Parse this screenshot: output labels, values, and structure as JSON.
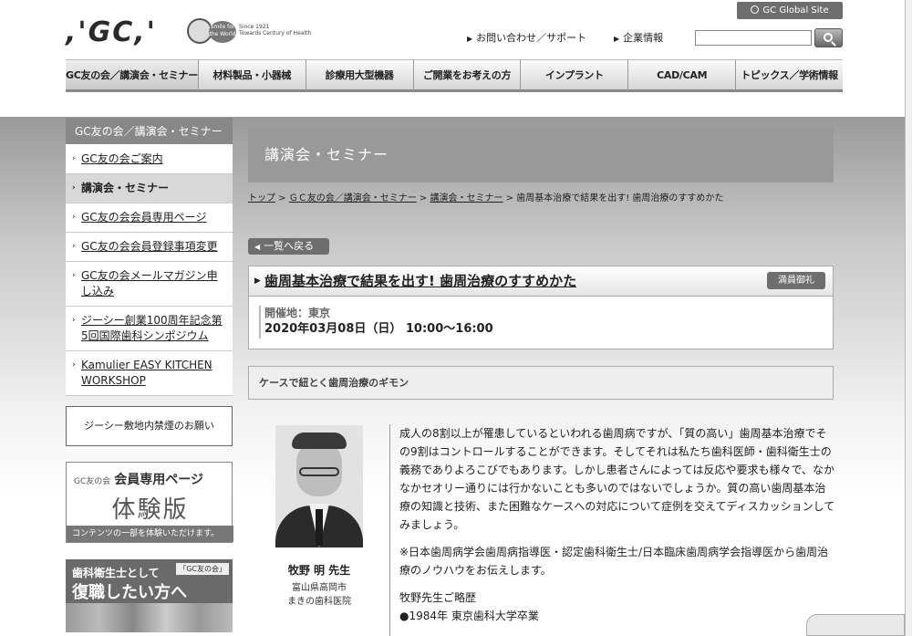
{
  "header": {
    "logo_text": ",'GC,'",
    "badge_text": "Smile for the World",
    "since_text": "Since 1921",
    "since_sub": "Towards Century of Health",
    "global_site": "GC Global Site",
    "utility_links": [
      "お問い合わせ／サポート",
      "企業情報"
    ],
    "search": {
      "value": "",
      "placeholder": ""
    }
  },
  "global_nav": [
    "GC友の会／講演会・セミナー",
    "材料製品・小器械",
    "診療用大型機器",
    "ご開業をお考えの方",
    "インプラント",
    "CAD/CAM",
    "トピックス／学術情報"
  ],
  "sidebar": {
    "heading": "GC友の会／講演会・セミナー",
    "items": [
      {
        "label": "GC友の会ご案内"
      },
      {
        "label": "講演会・セミナー"
      },
      {
        "label": "GC友の会会員専用ページ"
      },
      {
        "label": "GC友の会会員登録事項変更"
      },
      {
        "label": "GC友の会メールマガジン申し込み"
      },
      {
        "label": "ジーシー創業100周年記念第5回国際歯科シンポジウム"
      },
      {
        "label": "Kamulier EASY KITCHEN WORKSHOP"
      }
    ]
  },
  "banners": {
    "no_smoking": "ジーシー敷地内禁煙のお願い",
    "trial": {
      "small": "GC友の会",
      "title": "会員専用ページ",
      "big": "体験版",
      "caption": "コンテンツの一部を体験いただけます。"
    },
    "hygienist": {
      "line1": "歯科衛生士として",
      "line2": "復職したい方へ",
      "tag": "「GC友の会」"
    }
  },
  "main": {
    "page_title": "講演会・セミナー",
    "breadcrumb": [
      "トップ",
      "ＧＣ友の会／講演会・セミナー",
      "講演会・セミナー",
      "歯周基本治療で結果を出す! 歯周治療のすすめかた"
    ],
    "back_button": "一覧へ戻る",
    "event": {
      "title": "歯周基本治療で結果を出す! 歯周治療のすすめかた",
      "status": "満員御礼",
      "venue": "開催地：東京",
      "date": "2020年03月08日（日） 10:00〜16:00"
    },
    "subtitle": "ケースで紐とく歯周治療のギモン",
    "lecturer": {
      "name": "牧野 明 先生",
      "affiliation_1": "富山県高岡市",
      "affiliation_2": "まきの歯科医院"
    },
    "description": [
      "成人の8割以上が罹患しているといわれる歯周病ですが、「質の高い」歯周基本治療でその9割はコントロールすることができます。そしてそれは私たち歯科医師・歯科衛生士の義務でありよろこびでもあります。しかし患者さんによっては反応や要求も様々で、なかなかセオリー通りには行かないことも多いのではないでしょうか。質の高い歯周基本治療の知識と技術、また困難なケースへの対応について症例を交えてディスカッションしてみましょう。",
      "※日本歯周病学会歯周病指導医・認定歯科衛生士/日本臨床歯周病学会指導医から歯周治療のノウハウをお伝えします。",
      "牧野先生ご略歴",
      "●1984年 東京歯科大学卒業"
    ]
  }
}
